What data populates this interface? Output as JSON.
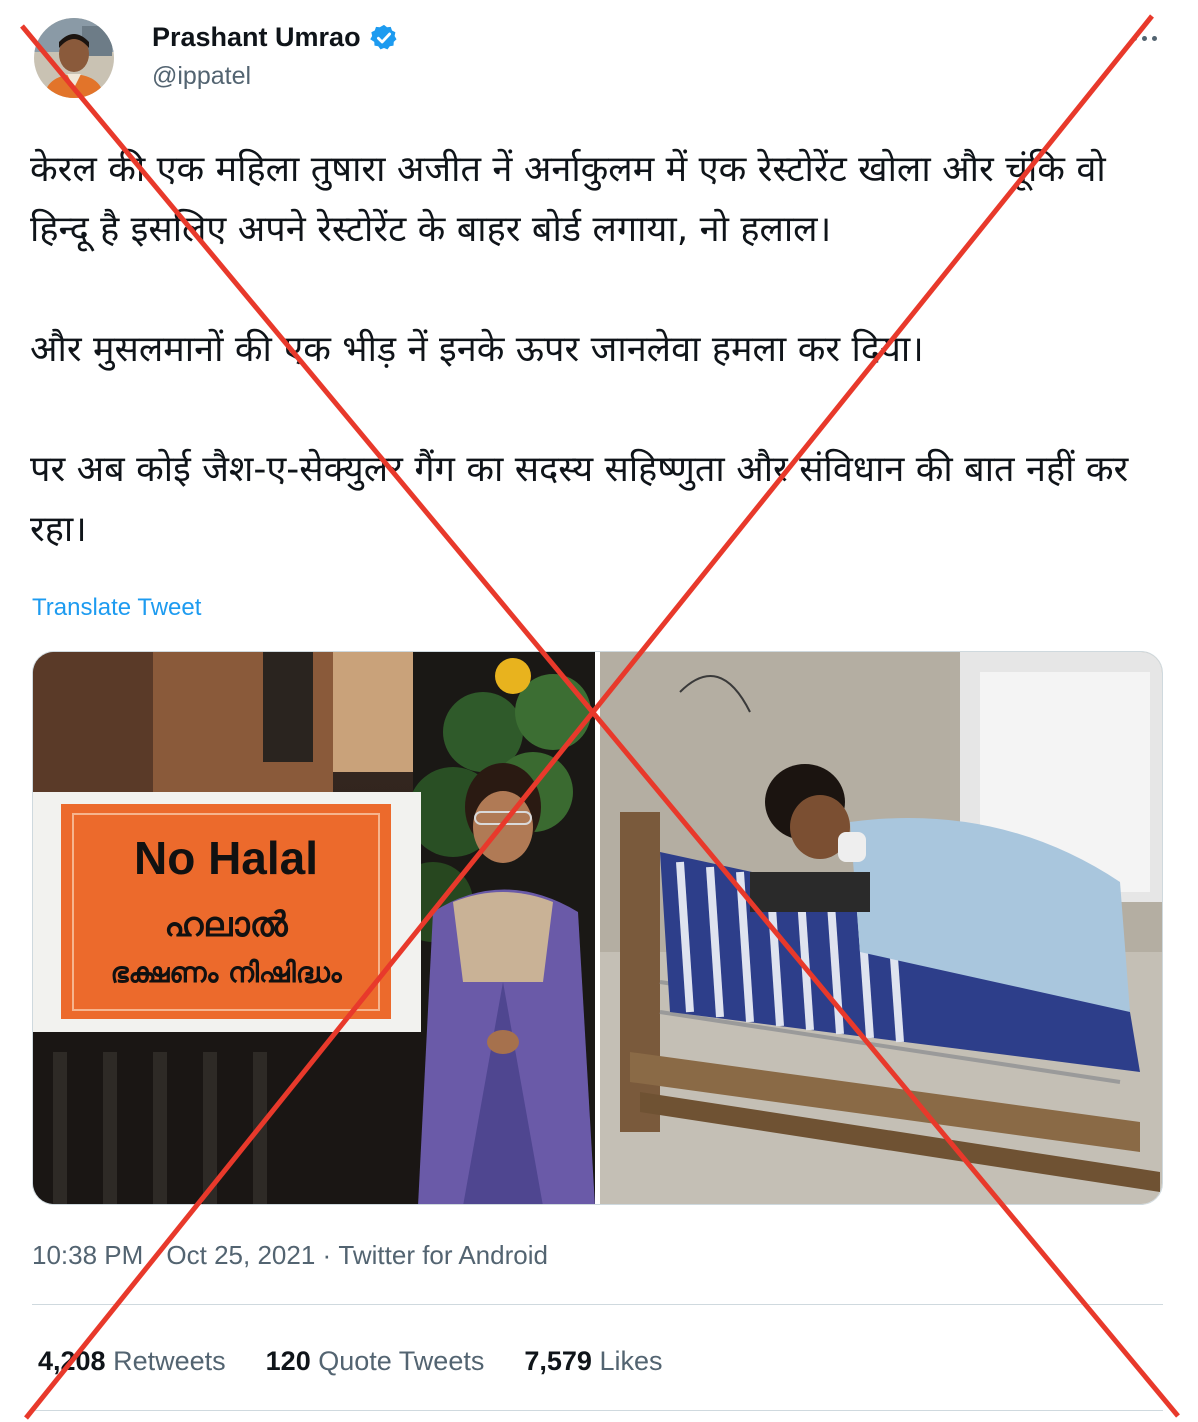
{
  "author": {
    "name": "Prashant Umrao",
    "handle": "@ippatel",
    "verified": true
  },
  "tweet": {
    "paragraphs": [
      "केरल की एक महिला तुषारा अजीत नें अर्नाकुलम में एक रेस्टोरेंट खोला और चूंकि वो हिन्दू है इसलिए अपने रेस्टोरेंट के बाहर बोर्ड लगाया, नो हलाल।",
      "और मुसलमानों की एक भीड़ नें इनके ऊपर जानलेवा हमला कर दिया।",
      "पर अब कोई जैश-ए-सेक्युलर गैंग का सदस्य सहिष्णुता और संविधान की बात नहीं कर रहा।"
    ],
    "translate_label": "Translate Tweet"
  },
  "media": {
    "sign_english": "No Halal",
    "sign_malayalam_line1": "ഹലാൽ",
    "sign_malayalam_line2": "ഭക്ഷണം നിഷിദ്ധം"
  },
  "meta": {
    "time": "10:38 PM",
    "date": "Oct 25, 2021",
    "source": "Twitter for Android",
    "separator": " · "
  },
  "stats": {
    "retweets_count": "4,208",
    "retweets_label": "Retweets",
    "quotes_count": "120",
    "quotes_label": "Quote Tweets",
    "likes_count": "7,579",
    "likes_label": "Likes"
  },
  "colors": {
    "link_blue": "#1d9bf0",
    "muted_text": "#536471",
    "overlay_red": "#e8392b",
    "sign_orange": "#ec6a2c"
  }
}
